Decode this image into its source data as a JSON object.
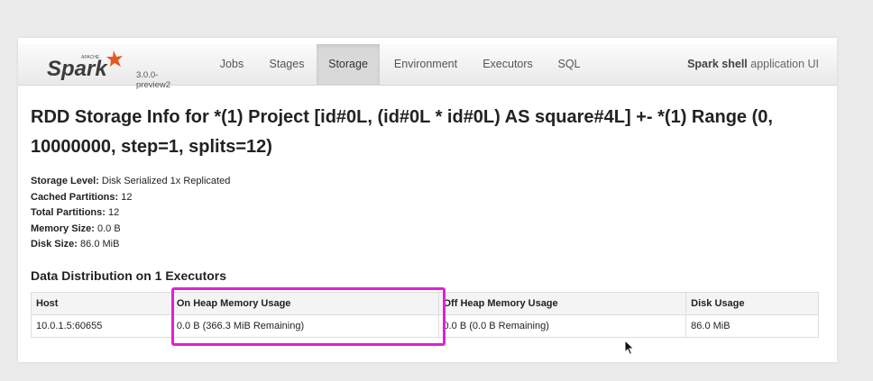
{
  "navbar": {
    "brand_small": "APACHE",
    "brand_name": "Spark",
    "version": "3.0.0-preview2",
    "tabs": [
      {
        "label": "Jobs",
        "active": false
      },
      {
        "label": "Stages",
        "active": false
      },
      {
        "label": "Storage",
        "active": true
      },
      {
        "label": "Environment",
        "active": false
      },
      {
        "label": "Executors",
        "active": false
      },
      {
        "label": "SQL",
        "active": false
      }
    ],
    "app_name": "Spark shell",
    "app_suffix": " application UI"
  },
  "title": "RDD Storage Info for *(1) Project [id#0L, (id#0L * id#0L) AS square#4L] +- *(1) Range (0, 10000000, step=1, splits=12)",
  "summary": [
    {
      "label": "Storage Level:",
      "value": " Disk Serialized 1x Replicated"
    },
    {
      "label": "Cached Partitions:",
      "value": " 12"
    },
    {
      "label": "Total Partitions:",
      "value": " 12"
    },
    {
      "label": "Memory Size:",
      "value": " 0.0 B"
    },
    {
      "label": "Disk Size:",
      "value": " 86.0 MiB"
    }
  ],
  "distribution": {
    "title": "Data Distribution on 1 Executors",
    "headers": [
      "Host",
      "On Heap Memory Usage",
      "Off Heap Memory Usage",
      "Disk Usage"
    ],
    "rows": [
      [
        "10.0.1.5:60655",
        "0.0 B (366.3 MiB Remaining)",
        "0.0 B (0.0 B Remaining)",
        "86.0 MiB"
      ]
    ]
  },
  "colors": {
    "highlight": "#e020d8",
    "spark_orange": "#e25a1c"
  }
}
